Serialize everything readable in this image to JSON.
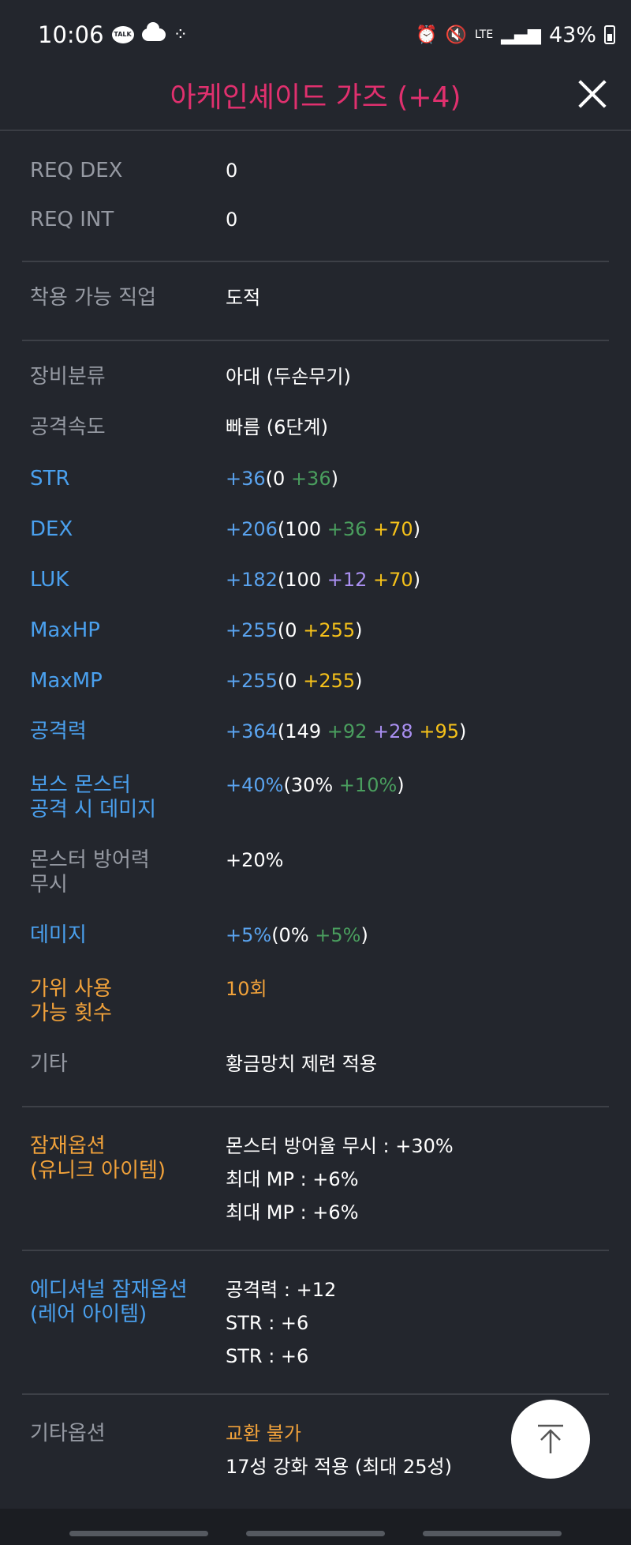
{
  "status_bar": {
    "time": "10:06",
    "talk_label": "TALK",
    "network": "LTE",
    "battery": "43%"
  },
  "header": {
    "title": "아케인셰이드 가즈 (+4)"
  },
  "req_stats": [
    {
      "label": "REQ DEX",
      "value": "0"
    },
    {
      "label": "REQ INT",
      "value": "0"
    }
  ],
  "job": {
    "label": "착용 가능 직업",
    "value": "도적"
  },
  "basic": [
    {
      "label": "장비분류",
      "value": "아대 (두손무기)"
    },
    {
      "label": "공격속도",
      "value": "빠름 (6단계)"
    }
  ],
  "stats": {
    "str": {
      "label": "STR",
      "total": "+36",
      "open": "(0",
      "parts": [
        "+36"
      ],
      "close": ")"
    },
    "dex": {
      "label": "DEX",
      "total": "+206",
      "open": "(100",
      "parts": [
        "+36",
        "+70"
      ],
      "close": ")"
    },
    "luk": {
      "label": "LUK",
      "total": "+182",
      "open": "(100",
      "parts": [
        "+12",
        "+70"
      ],
      "close": ")"
    },
    "maxhp": {
      "label": "MaxHP",
      "total": "+255",
      "open": "(0",
      "parts": [
        "+255"
      ],
      "close": ")"
    },
    "maxmp": {
      "label": "MaxMP",
      "total": "+255",
      "open": "(0",
      "parts": [
        "+255"
      ],
      "close": ")"
    },
    "attack": {
      "label": "공격력",
      "total": "+364",
      "open": "(149",
      "parts": [
        "+92",
        "+28",
        "+95"
      ],
      "close": ")"
    },
    "boss": {
      "label_line1": "보스 몬스터",
      "label_line2": "공격 시 데미지",
      "total": "+40%",
      "open": "(30%",
      "parts": [
        "+10%"
      ],
      "close": ")"
    },
    "ignore_def": {
      "label_line1": "몬스터 방어력",
      "label_line2": "무시",
      "value": "+20%"
    },
    "damage": {
      "label": "데미지",
      "total": "+5%",
      "open": "(0%",
      "parts": [
        "+5%"
      ],
      "close": ")"
    },
    "scissors": {
      "label_line1": "가위 사용",
      "label_line2": "가능 횟수",
      "value": "10회"
    },
    "etc": {
      "label": "기타",
      "value": "황금망치 제련 적용"
    }
  },
  "potential": {
    "label_line1": "잠재옵션",
    "label_line2": "(유니크 아이템)",
    "lines": [
      "몬스터 방어율 무시 : +30%",
      "최대 MP : +6%",
      "최대 MP : +6%"
    ]
  },
  "additional_potential": {
    "label_line1": "에디셔널 잠재옵션",
    "label_line2": "(레어 아이템)",
    "lines": [
      "공격력 : +12",
      "STR : +6",
      "STR : +6"
    ]
  },
  "other_options": {
    "label": "기타옵션",
    "lines": [
      "교환 불가",
      "17성 강화 적용 (최대 25성)"
    ]
  },
  "colors": {
    "background": "#23262d",
    "title": "#e0306e",
    "label_gray": "#969aa3",
    "label_blue": "#4aa0ee",
    "label_orange": "#f0a13a",
    "total_blue": "#5aa3ee",
    "base_green": "#4a9e5e",
    "enhance_purple": "#a98ff0",
    "star_yellow": "#f5c11a"
  }
}
